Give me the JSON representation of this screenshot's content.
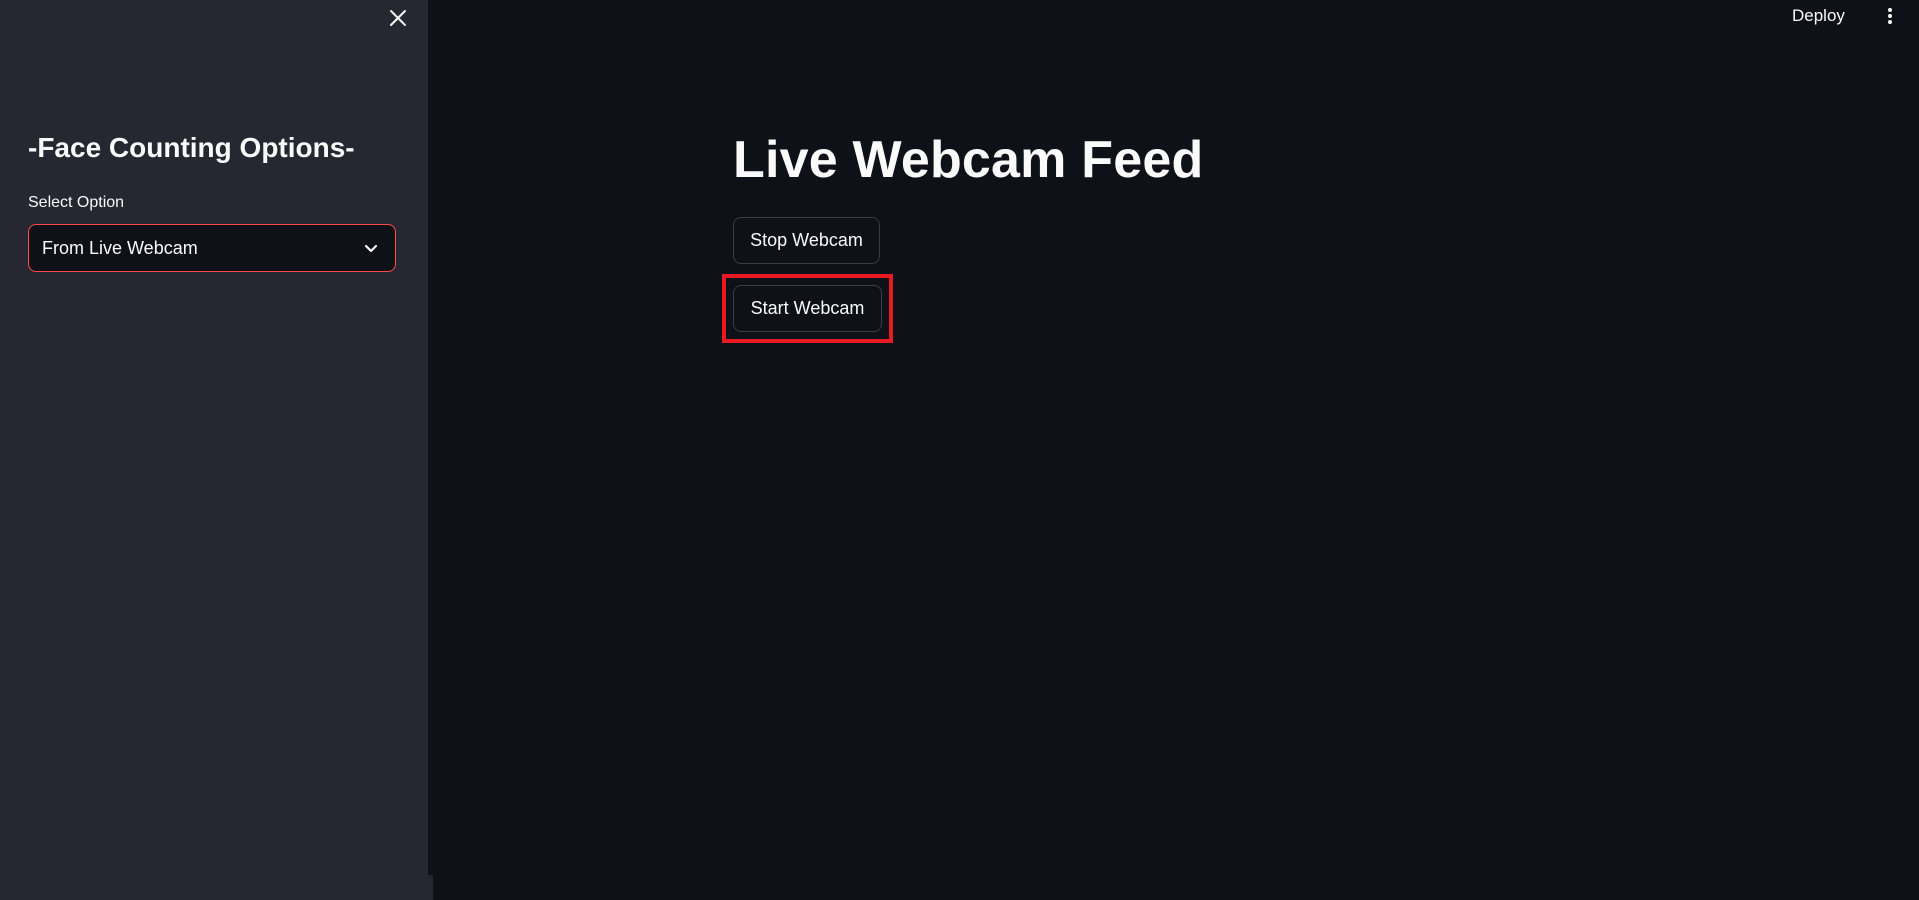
{
  "sidebar": {
    "title": "-Face Counting Options-",
    "select_label": "Select Option",
    "select_value": "From Live Webcam",
    "close_icon": "close-icon",
    "chevron_icon": "chevron-down-icon",
    "background_color": "#262730",
    "select_border_color": "#ff4b4b"
  },
  "header": {
    "deploy_label": "Deploy",
    "menu_icon": "kebab-menu-icon"
  },
  "main": {
    "title": "Live Webcam Feed",
    "stop_button_label": "Stop Webcam",
    "start_button_label": "Start Webcam",
    "background_color": "#0e1117",
    "highlight_color": "#e8191f"
  }
}
